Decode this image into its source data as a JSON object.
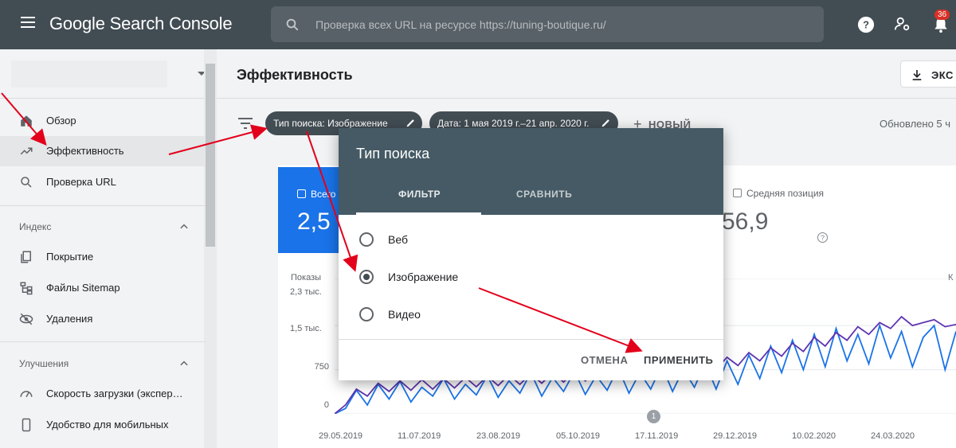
{
  "app": {
    "title": "Google Search Console"
  },
  "search": {
    "placeholder": "Проверка всех URL на ресурсе https://tuning-boutique.ru/"
  },
  "notifications": {
    "count": "36"
  },
  "sidebar": {
    "items": [
      {
        "label": "Обзор",
        "icon": "home-icon"
      },
      {
        "label": "Эффективность",
        "icon": "trending-up-icon"
      },
      {
        "label": "Проверка URL",
        "icon": "search-icon"
      }
    ],
    "section_index": "Индекс",
    "index_items": [
      {
        "label": "Покрытие",
        "icon": "coverage-icon"
      },
      {
        "label": "Файлы Sitemap",
        "icon": "sitemap-icon"
      },
      {
        "label": "Удаления",
        "icon": "removals-icon"
      }
    ],
    "section_enhancements": "Улучшения",
    "enh_items": [
      {
        "label": "Скорость загрузки (экспер…",
        "icon": "speed-icon"
      },
      {
        "label": "Удобство для мобильных",
        "icon": "mobile-icon"
      }
    ]
  },
  "main": {
    "title": "Эффективность",
    "export_label": "ЭКС",
    "filters": {
      "search_type_chip": "Тип поиска: Изображение",
      "date_chip": "Дата: 1 мая 2019 г.–21 апр. 2020 г.",
      "new_label": "НОВЫЙ",
      "updated": "Обновлено 5 ч"
    },
    "metrics": {
      "clicks_label": "Всего",
      "clicks_value": "2,5",
      "position_label": "Средняя позиция",
      "position_value": "56,9"
    }
  },
  "chart_data": {
    "type": "line",
    "ylabel": "Показы",
    "y_ticks": [
      "2,3 тыс.",
      "1,5 тыс.",
      "750",
      "0"
    ],
    "x_ticks": [
      "29.05.2019",
      "11.07.2019",
      "23.08.2019",
      "05.10.2019",
      "17.11.2019",
      "29.12.2019",
      "10.02.2020",
      "24.03.2020"
    ],
    "annotation": "1",
    "right_label": "К",
    "ylim": [
      0,
      2300
    ],
    "series": [
      {
        "color": "#1a73e8",
        "values": [
          0,
          90,
          400,
          150,
          500,
          250,
          550,
          200,
          450,
          300,
          600,
          250,
          500,
          320,
          650,
          280,
          560,
          350,
          700,
          300,
          620,
          380,
          720,
          330,
          650,
          400,
          780,
          350,
          700,
          420,
          820,
          380,
          760,
          450,
          860,
          420,
          900,
          500,
          1000,
          600,
          1150,
          700,
          1250,
          750,
          1350,
          800,
          1450,
          900,
          1350,
          850,
          1500,
          950,
          1400,
          800,
          1300,
          1500,
          750,
          1400
        ]
      },
      {
        "color": "#5e35b1",
        "values": [
          0,
          150,
          420,
          300,
          520,
          380,
          560,
          400,
          580,
          420,
          600,
          440,
          620,
          460,
          640,
          480,
          660,
          500,
          680,
          520,
          700,
          540,
          720,
          560,
          740,
          580,
          760,
          600,
          780,
          620,
          800,
          650,
          840,
          700,
          900,
          760,
          960,
          820,
          1040,
          900,
          1120,
          980,
          1200,
          1060,
          1300,
          1150,
          1380,
          1250,
          1480,
          1350,
          1550,
          1450,
          1650,
          1500,
          1550,
          1600,
          1480,
          1520
        ]
      }
    ]
  },
  "dialog": {
    "title": "Тип поиска",
    "tab_filter": "ФИЛЬТР",
    "tab_compare": "СРАВНИТЬ",
    "options": [
      "Веб",
      "Изображение",
      "Видео"
    ],
    "selected": "Изображение",
    "cancel": "ОТМЕНА",
    "apply": "ПРИМЕНИТЬ"
  }
}
